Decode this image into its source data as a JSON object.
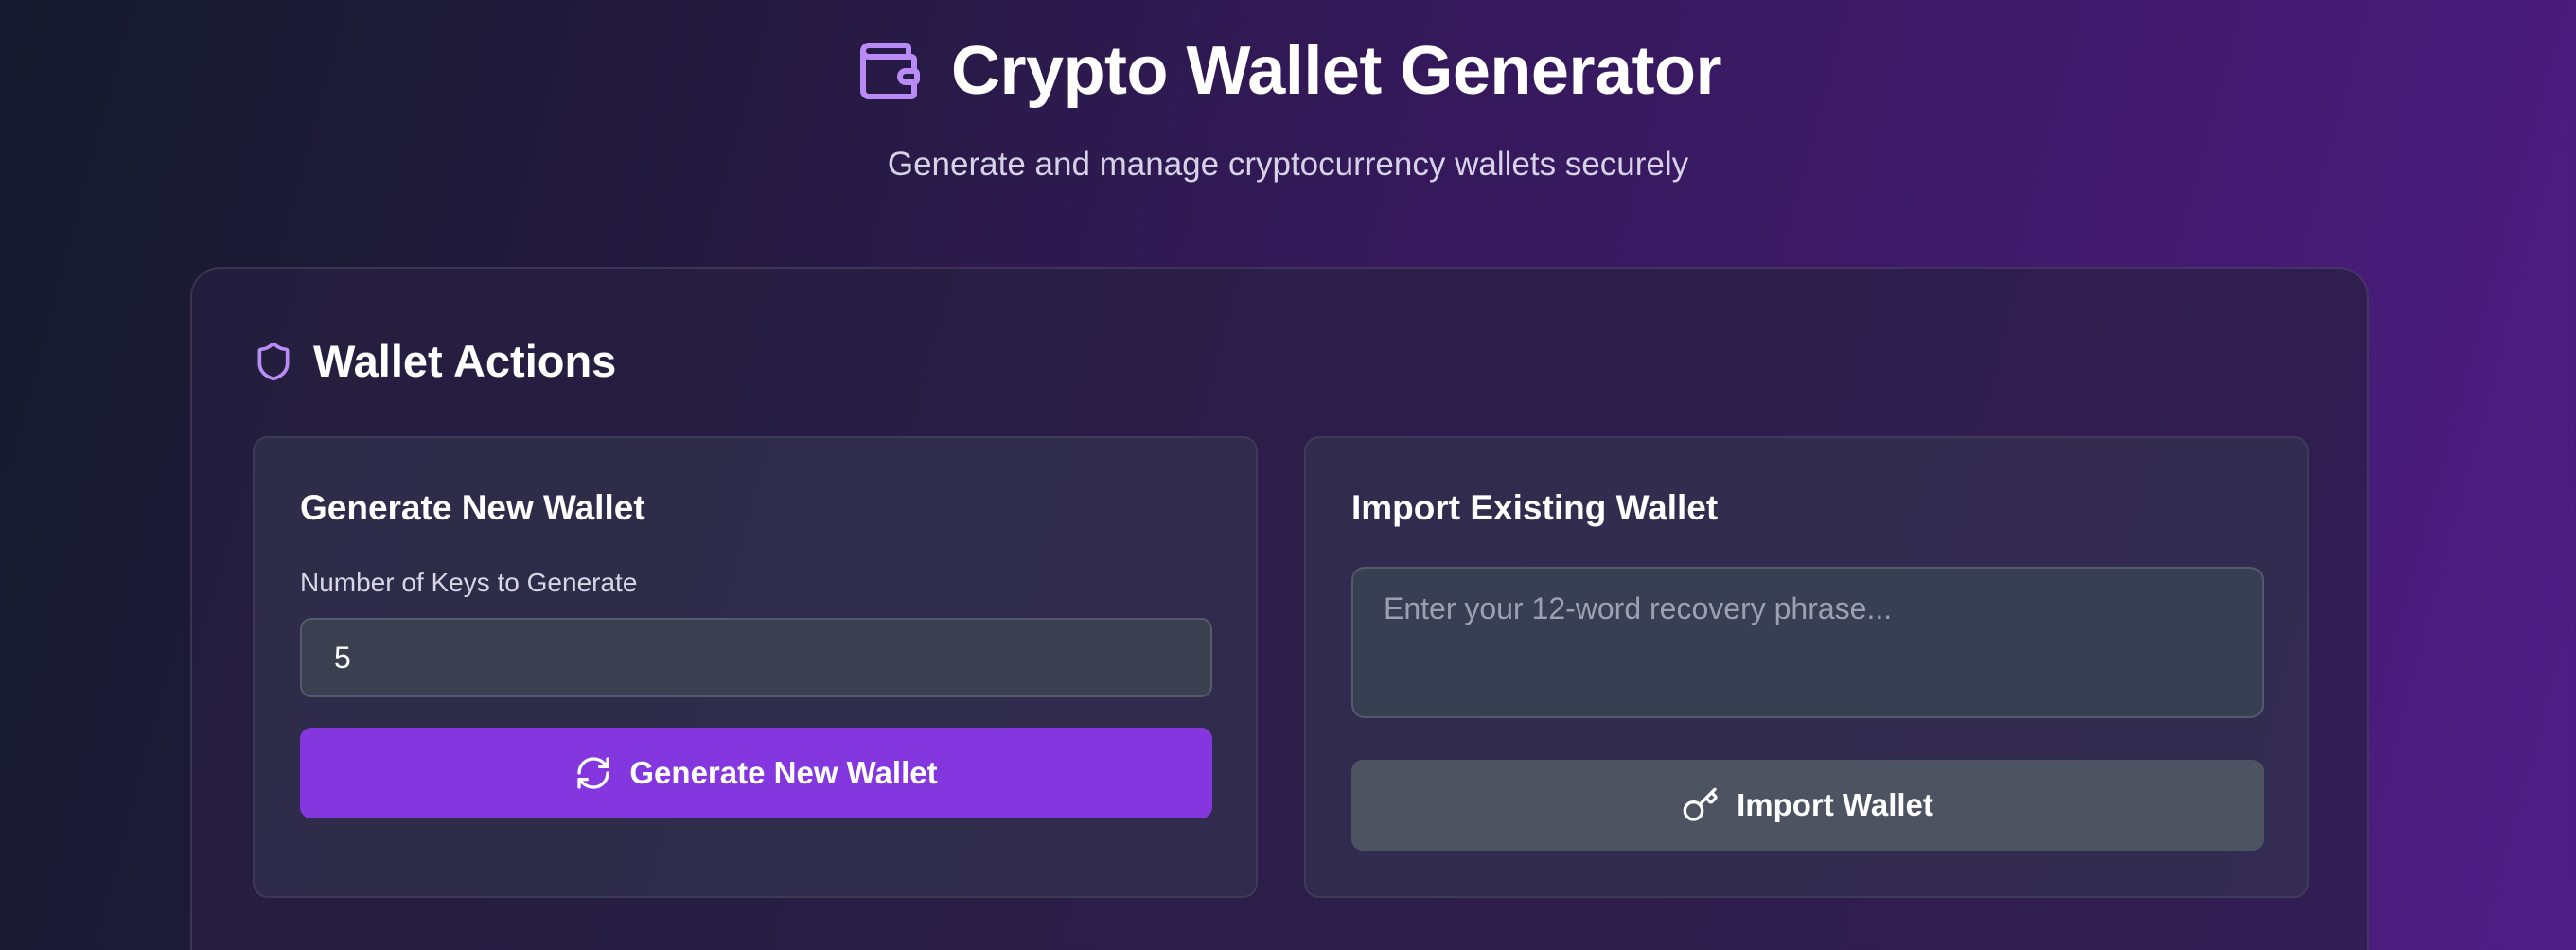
{
  "header": {
    "title": "Crypto Wallet Generator",
    "subtitle": "Generate and manage cryptocurrency wallets securely",
    "icon": "wallet-icon"
  },
  "panel": {
    "title": "Wallet Actions",
    "icon": "shield-icon"
  },
  "generate_card": {
    "title": "Generate New Wallet",
    "keys_label": "Number of Keys to Generate",
    "keys_value": "5",
    "button_label": "Generate New Wallet",
    "button_icon": "refresh-icon"
  },
  "import_card": {
    "title": "Import Existing Wallet",
    "phrase_placeholder": "Enter your 12-word recovery phrase...",
    "button_label": "Import Wallet",
    "button_icon": "key-icon"
  },
  "colors": {
    "accent": "#8437df",
    "icon_purple": "#b98cf5",
    "secondary_button": "#4d5361"
  }
}
